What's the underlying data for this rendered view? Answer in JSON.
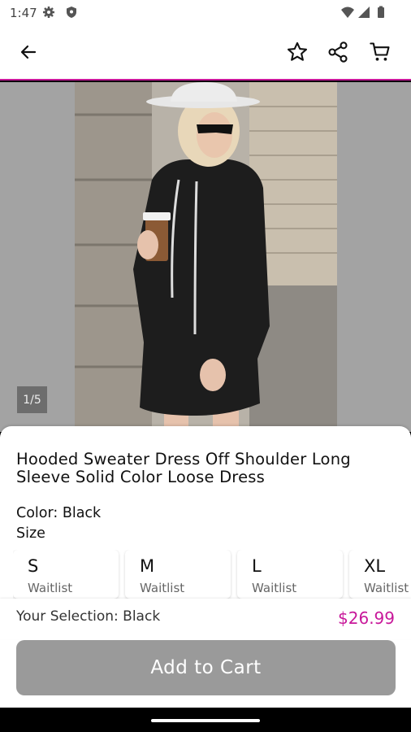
{
  "status_bar": {
    "time": "1:47",
    "icons": [
      "gear-icon",
      "shield-icon",
      "wifi-icon",
      "signal-icon",
      "battery-icon"
    ]
  },
  "app_bar": {
    "icons": [
      "back-arrow-icon",
      "star-icon",
      "share-icon",
      "cart-icon"
    ],
    "accent_color": "#c8189a"
  },
  "gallery": {
    "counter": "1/5"
  },
  "product": {
    "title": "Hooded Sweater Dress Off Shoulder Long Sleeve Solid Color Loose Dress",
    "color_line": "Color: Black",
    "size_label": "Size",
    "sizes": [
      {
        "size": "S",
        "status": "Waitlist"
      },
      {
        "size": "M",
        "status": "Waitlist"
      },
      {
        "size": "L",
        "status": "Waitlist"
      },
      {
        "size": "XL",
        "status": "Waitlist"
      }
    ]
  },
  "selection": {
    "text": "Your Selection: Black",
    "price": "$26.99",
    "price_color": "#c8189a"
  },
  "cta": {
    "label": "Add to Cart"
  }
}
